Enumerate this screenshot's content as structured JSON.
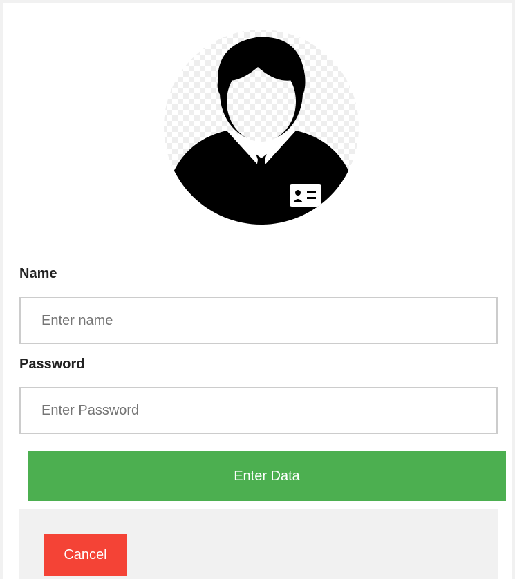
{
  "avatar": {
    "icon": "user-id-card-avatar"
  },
  "form": {
    "name_label": "Name",
    "name_placeholder": "Enter name",
    "name_value": "",
    "password_label": "Password",
    "password_placeholder": "Enter Password",
    "password_value": "",
    "submit_label": "Enter Data",
    "cancel_label": "Cancel"
  },
  "colors": {
    "submit": "#4caf50",
    "cancel": "#f44336",
    "footer": "#f1f1f1"
  }
}
